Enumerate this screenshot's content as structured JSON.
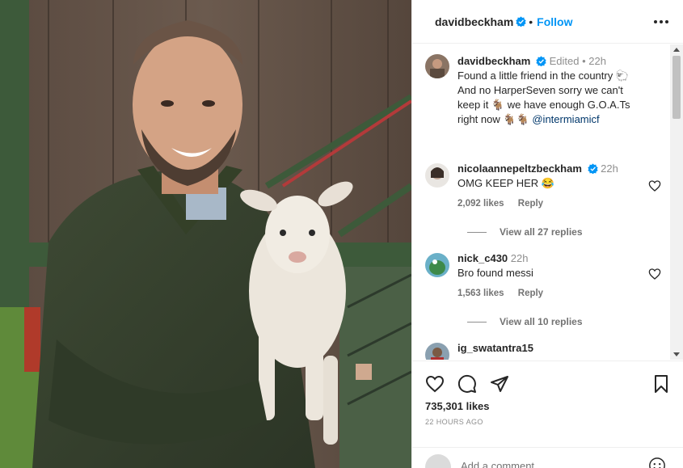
{
  "colors": {
    "accent": "#0095f6",
    "verified": "#0095f6",
    "text": "#262626",
    "muted": "#737373"
  },
  "header": {
    "username": "davidbeckham",
    "follow_label": "Follow",
    "separator": "•"
  },
  "caption": {
    "username": "davidbeckham",
    "edited": "Edited",
    "dot": "•",
    "age": "22h",
    "line1": "Found a little friend in the country 🐑",
    "line2": "And no HarperSeven sorry we can't",
    "line3": "keep it 🐐 we have enough G.O.A.Ts",
    "line4_text": "right now 🐐🐐 ",
    "mention": "@intermiamicf"
  },
  "comments": [
    {
      "username": "nicolaannepeltzbeckham",
      "verified": true,
      "age": "22h",
      "text": "OMG KEEP HER 😂",
      "likes": "2,092 likes",
      "reply": "Reply",
      "view_replies": "View all 27 replies"
    },
    {
      "username": "nick_c430",
      "verified": false,
      "age": "22h",
      "text": "Bro found messi",
      "likes": "1,563 likes",
      "reply": "Reply",
      "view_replies": "View all 10 replies"
    },
    {
      "username": "ig_swatantra15",
      "verified": false
    }
  ],
  "actions": {
    "icons": [
      "heart-icon",
      "comment-icon",
      "share-icon",
      "bookmark-icon"
    ],
    "likes": "735,301 likes",
    "timestamp": "22 HOURS AGO"
  },
  "add_comment": {
    "placeholder": "Add a comment..."
  }
}
